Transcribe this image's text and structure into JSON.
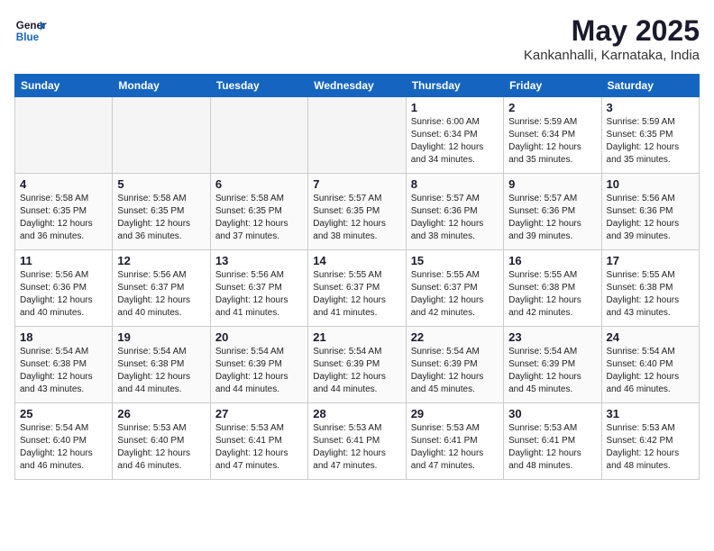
{
  "header": {
    "logo_line1": "General",
    "logo_line2": "Blue",
    "month_year": "May 2025",
    "location": "Kankanhalli, Karnataka, India"
  },
  "weekdays": [
    "Sunday",
    "Monday",
    "Tuesday",
    "Wednesday",
    "Thursday",
    "Friday",
    "Saturday"
  ],
  "weeks": [
    [
      {
        "day": "",
        "empty": true
      },
      {
        "day": "",
        "empty": true
      },
      {
        "day": "",
        "empty": true
      },
      {
        "day": "",
        "empty": true
      },
      {
        "day": "1",
        "sunrise": "Sunrise: 6:00 AM",
        "sunset": "Sunset: 6:34 PM",
        "daylight": "Daylight: 12 hours and 34 minutes."
      },
      {
        "day": "2",
        "sunrise": "Sunrise: 5:59 AM",
        "sunset": "Sunset: 6:34 PM",
        "daylight": "Daylight: 12 hours and 35 minutes."
      },
      {
        "day": "3",
        "sunrise": "Sunrise: 5:59 AM",
        "sunset": "Sunset: 6:35 PM",
        "daylight": "Daylight: 12 hours and 35 minutes."
      }
    ],
    [
      {
        "day": "4",
        "sunrise": "Sunrise: 5:58 AM",
        "sunset": "Sunset: 6:35 PM",
        "daylight": "Daylight: 12 hours and 36 minutes."
      },
      {
        "day": "5",
        "sunrise": "Sunrise: 5:58 AM",
        "sunset": "Sunset: 6:35 PM",
        "daylight": "Daylight: 12 hours and 36 minutes."
      },
      {
        "day": "6",
        "sunrise": "Sunrise: 5:58 AM",
        "sunset": "Sunset: 6:35 PM",
        "daylight": "Daylight: 12 hours and 37 minutes."
      },
      {
        "day": "7",
        "sunrise": "Sunrise: 5:57 AM",
        "sunset": "Sunset: 6:35 PM",
        "daylight": "Daylight: 12 hours and 38 minutes."
      },
      {
        "day": "8",
        "sunrise": "Sunrise: 5:57 AM",
        "sunset": "Sunset: 6:36 PM",
        "daylight": "Daylight: 12 hours and 38 minutes."
      },
      {
        "day": "9",
        "sunrise": "Sunrise: 5:57 AM",
        "sunset": "Sunset: 6:36 PM",
        "daylight": "Daylight: 12 hours and 39 minutes."
      },
      {
        "day": "10",
        "sunrise": "Sunrise: 5:56 AM",
        "sunset": "Sunset: 6:36 PM",
        "daylight": "Daylight: 12 hours and 39 minutes."
      }
    ],
    [
      {
        "day": "11",
        "sunrise": "Sunrise: 5:56 AM",
        "sunset": "Sunset: 6:36 PM",
        "daylight": "Daylight: 12 hours and 40 minutes."
      },
      {
        "day": "12",
        "sunrise": "Sunrise: 5:56 AM",
        "sunset": "Sunset: 6:37 PM",
        "daylight": "Daylight: 12 hours and 40 minutes."
      },
      {
        "day": "13",
        "sunrise": "Sunrise: 5:56 AM",
        "sunset": "Sunset: 6:37 PM",
        "daylight": "Daylight: 12 hours and 41 minutes."
      },
      {
        "day": "14",
        "sunrise": "Sunrise: 5:55 AM",
        "sunset": "Sunset: 6:37 PM",
        "daylight": "Daylight: 12 hours and 41 minutes."
      },
      {
        "day": "15",
        "sunrise": "Sunrise: 5:55 AM",
        "sunset": "Sunset: 6:37 PM",
        "daylight": "Daylight: 12 hours and 42 minutes."
      },
      {
        "day": "16",
        "sunrise": "Sunrise: 5:55 AM",
        "sunset": "Sunset: 6:38 PM",
        "daylight": "Daylight: 12 hours and 42 minutes."
      },
      {
        "day": "17",
        "sunrise": "Sunrise: 5:55 AM",
        "sunset": "Sunset: 6:38 PM",
        "daylight": "Daylight: 12 hours and 43 minutes."
      }
    ],
    [
      {
        "day": "18",
        "sunrise": "Sunrise: 5:54 AM",
        "sunset": "Sunset: 6:38 PM",
        "daylight": "Daylight: 12 hours and 43 minutes."
      },
      {
        "day": "19",
        "sunrise": "Sunrise: 5:54 AM",
        "sunset": "Sunset: 6:38 PM",
        "daylight": "Daylight: 12 hours and 44 minutes."
      },
      {
        "day": "20",
        "sunrise": "Sunrise: 5:54 AM",
        "sunset": "Sunset: 6:39 PM",
        "daylight": "Daylight: 12 hours and 44 minutes."
      },
      {
        "day": "21",
        "sunrise": "Sunrise: 5:54 AM",
        "sunset": "Sunset: 6:39 PM",
        "daylight": "Daylight: 12 hours and 44 minutes."
      },
      {
        "day": "22",
        "sunrise": "Sunrise: 5:54 AM",
        "sunset": "Sunset: 6:39 PM",
        "daylight": "Daylight: 12 hours and 45 minutes."
      },
      {
        "day": "23",
        "sunrise": "Sunrise: 5:54 AM",
        "sunset": "Sunset: 6:39 PM",
        "daylight": "Daylight: 12 hours and 45 minutes."
      },
      {
        "day": "24",
        "sunrise": "Sunrise: 5:54 AM",
        "sunset": "Sunset: 6:40 PM",
        "daylight": "Daylight: 12 hours and 46 minutes."
      }
    ],
    [
      {
        "day": "25",
        "sunrise": "Sunrise: 5:54 AM",
        "sunset": "Sunset: 6:40 PM",
        "daylight": "Daylight: 12 hours and 46 minutes."
      },
      {
        "day": "26",
        "sunrise": "Sunrise: 5:53 AM",
        "sunset": "Sunset: 6:40 PM",
        "daylight": "Daylight: 12 hours and 46 minutes."
      },
      {
        "day": "27",
        "sunrise": "Sunrise: 5:53 AM",
        "sunset": "Sunset: 6:41 PM",
        "daylight": "Daylight: 12 hours and 47 minutes."
      },
      {
        "day": "28",
        "sunrise": "Sunrise: 5:53 AM",
        "sunset": "Sunset: 6:41 PM",
        "daylight": "Daylight: 12 hours and 47 minutes."
      },
      {
        "day": "29",
        "sunrise": "Sunrise: 5:53 AM",
        "sunset": "Sunset: 6:41 PM",
        "daylight": "Daylight: 12 hours and 47 minutes."
      },
      {
        "day": "30",
        "sunrise": "Sunrise: 5:53 AM",
        "sunset": "Sunset: 6:41 PM",
        "daylight": "Daylight: 12 hours and 48 minutes."
      },
      {
        "day": "31",
        "sunrise": "Sunrise: 5:53 AM",
        "sunset": "Sunset: 6:42 PM",
        "daylight": "Daylight: 12 hours and 48 minutes."
      }
    ]
  ]
}
